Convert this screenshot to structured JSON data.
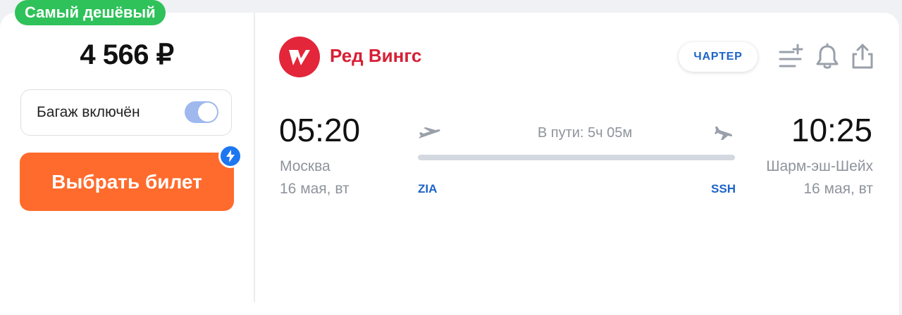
{
  "left_panel": {
    "badge": "Самый дешёвый",
    "price": "4 566 ₽",
    "baggage_label": "Багаж включён",
    "baggage_toggle_on": true,
    "select_button": "Выбрать билет"
  },
  "flight": {
    "airline_name": "Ред Вингс",
    "charter_label": "ЧАРТЕР",
    "departure_time": "05:20",
    "departure_city": "Москва",
    "departure_date": "16 мая, вт",
    "departure_code": "ZIA",
    "arrival_time": "10:25",
    "arrival_city": "Шарм-эш-Шейх",
    "arrival_date": "16 мая, вт",
    "arrival_code": "SSH",
    "duration": "В пути: 5ч 05м"
  },
  "colors": {
    "badge_green": "#2fc15a",
    "button_orange": "#ff6b2c",
    "airline_red": "#d71f35",
    "link_blue": "#1d64c9",
    "toggle_blue": "#9fb9ef"
  },
  "icons": {
    "actions": [
      "add-to-list-icon",
      "bell-icon",
      "share-icon"
    ],
    "left_plane": "takeoff-plane-icon",
    "right_plane": "landing-plane-icon",
    "lightning": "lightning-icon"
  }
}
